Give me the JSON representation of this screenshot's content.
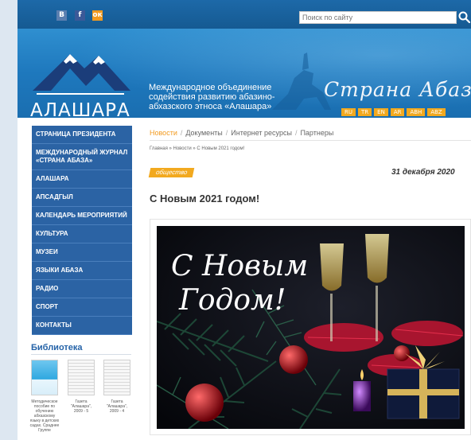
{
  "social": {
    "vk": "В",
    "fb": "f",
    "ok": "ок"
  },
  "search": {
    "placeholder": "Поиск по сайту"
  },
  "header": {
    "logo_text": "АЛАШАРА",
    "org_name": "Международное объединение содействия развитию абазино-абхазского этноса «Алашара»",
    "brand": "Страна Абаза",
    "languages": [
      "RU",
      "TR",
      "EN",
      "AR",
      "ABH",
      "ABZ"
    ]
  },
  "sidebar": {
    "items": [
      {
        "label": "СТРАНИЦА ПРЕЗИДЕНТА"
      },
      {
        "label": "МЕЖДУНАРОДНЫЙ ЖУРНАЛ «СТРАНА АБАЗА»"
      },
      {
        "label": "АЛАШАРА"
      },
      {
        "label": "АПСАДГЫЛ"
      },
      {
        "label": "КАЛЕНДАРЬ МЕРОПРИЯТИЙ"
      },
      {
        "label": "КУЛЬТУРА"
      },
      {
        "label": "МУЗЕИ"
      },
      {
        "label": "ЯЗЫКИ АБАЗА"
      },
      {
        "label": "РАДИО"
      },
      {
        "label": "СПОРТ"
      },
      {
        "label": "КОНТАКТЫ"
      }
    ]
  },
  "library": {
    "title": "Библиотека",
    "books": [
      {
        "caption": "Методическое пособие по обучению абхазскому языку в детских садах. Сраднее Группе"
      },
      {
        "caption": "Газета \"Алашара\", 2009 - 5"
      },
      {
        "caption": "Газета \"Алашара\", 2009 - 4"
      }
    ]
  },
  "tabs": [
    "Новости",
    "Документы",
    "Интернет ресурсы",
    "Партнеры"
  ],
  "breadcrumb": [
    "Главная",
    "Новости",
    "С Новым 2021 годом!"
  ],
  "article": {
    "tag": "общество",
    "date": "31 декабря 2020",
    "title": "С Новым 2021 годом!",
    "image_text_line1": "С Новым",
    "image_text_line2": "Годом!"
  },
  "colors": {
    "accent": "#f2a91f",
    "nav": "#2b63a4",
    "banner": "#1e78bd"
  }
}
